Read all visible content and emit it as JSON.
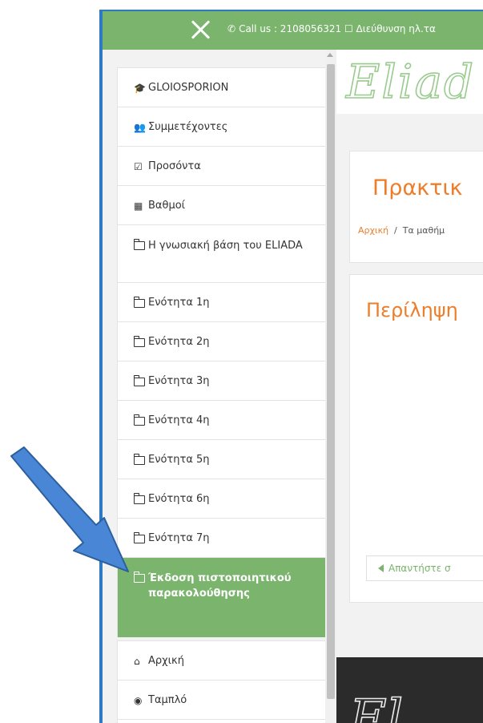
{
  "topbar": {
    "contact_text": "Call us : 2108056321 ☐ Διεύθυνση ηλ.τα"
  },
  "sidebar": {
    "items": [
      {
        "label": "GLOIOSPORION",
        "icon": "graduation-cap-icon"
      },
      {
        "label": "Συμμετέχοντες",
        "icon": "users-icon"
      },
      {
        "label": "Προσόντα",
        "icon": "checkbox-icon"
      },
      {
        "label": "Βαθμοί",
        "icon": "table-icon"
      },
      {
        "label": "Η γνωσιακή βάση του ELIADA",
        "icon": "folder-icon"
      },
      {
        "label": "Ενότητα 1η",
        "icon": "folder-icon"
      },
      {
        "label": "Ενότητα 2η",
        "icon": "folder-icon"
      },
      {
        "label": "Ενότητα 3η",
        "icon": "folder-icon"
      },
      {
        "label": "Ενότητα 4η",
        "icon": "folder-icon"
      },
      {
        "label": "Ενότητα 5η",
        "icon": "folder-icon"
      },
      {
        "label": "Ενότητα 6η",
        "icon": "folder-icon"
      },
      {
        "label": "Ενότητα 7η",
        "icon": "folder-icon"
      },
      {
        "label": "Έκδοση πιστοποιητικού παρακολούθησης",
        "icon": "folder-icon"
      },
      {
        "label": "Αρχική",
        "icon": "home-icon"
      },
      {
        "label": "Ταμπλό",
        "icon": "dashboard-icon"
      }
    ]
  },
  "main": {
    "logo_text": "Eliad",
    "page_title": "Πρακτικ",
    "breadcrumb": {
      "home": "Αρχική",
      "separator": "/",
      "current": "Τα μαθήμ"
    },
    "summary_heading": "Περίληψη",
    "answer_button": "Απαντήστε σ",
    "footer_logo": "El"
  },
  "colors": {
    "brand_green": "#7ab46d",
    "accent_orange": "#ee7d2a",
    "frame_blue": "#2f79c4",
    "annotation_arrow": "#4a86d6"
  }
}
